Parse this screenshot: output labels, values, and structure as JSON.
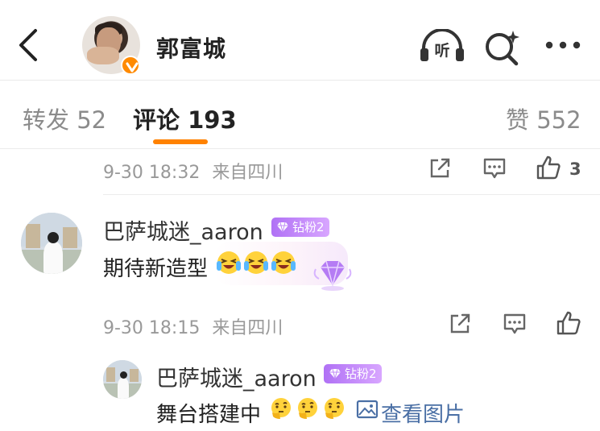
{
  "header": {
    "title": "郭富城",
    "listen_icon_label": "听",
    "icons": [
      "back-arrow-icon",
      "verified-v-icon",
      "headphones-listen-icon",
      "search-sparkle-icon",
      "more-icon"
    ],
    "accent": "#ff8200"
  },
  "tabs": {
    "repost": "转发 52",
    "comments": "评论 193",
    "likes": "赞 552"
  },
  "comment0": {
    "date": "9-30 18:32",
    "source": "来自四川",
    "like_count": "3"
  },
  "comment1": {
    "username": "巴萨城迷_aaron",
    "badge": "钻粉2",
    "text": "期待新造型",
    "emojis": [
      "crying-laughing-emoji",
      "crying-laughing-emoji",
      "crying-laughing-emoji"
    ],
    "date": "9-30 18:15",
    "source": "来自四川",
    "badge_color": "#b071f5"
  },
  "reply": {
    "username": "巴萨城迷_aaron",
    "badge": "钻粉2",
    "text": "舞台搭建中",
    "emojis": [
      "thinking-emoji",
      "thinking-emoji",
      "thinking-emoji"
    ],
    "view_image": "查看图片",
    "link_color": "#4a6fa5"
  }
}
